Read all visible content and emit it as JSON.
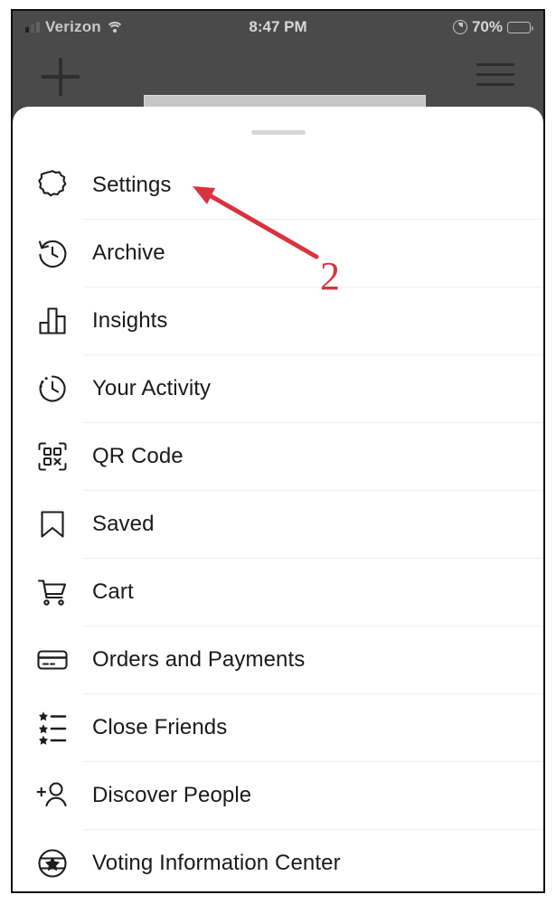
{
  "status_bar": {
    "carrier": "Verizon",
    "time": "8:47 PM",
    "battery_percent": "70%",
    "battery_level": 70,
    "wifi_icon": "wifi-icon",
    "signal_icon": "cellular-signal-icon",
    "location_icon": "location-services-icon",
    "battery_icon": "battery-icon"
  },
  "app_bar": {
    "add_icon": "plus-icon",
    "menu_icon": "hamburger-menu-icon",
    "username_redacted": ""
  },
  "sheet": {
    "grabber": "drag-handle",
    "items": [
      {
        "label": "Settings",
        "icon": "gear-icon"
      },
      {
        "label": "Archive",
        "icon": "archive-clock-icon"
      },
      {
        "label": "Insights",
        "icon": "insights-bar-chart-icon"
      },
      {
        "label": "Your Activity",
        "icon": "activity-clock-icon"
      },
      {
        "label": "QR Code",
        "icon": "qr-code-icon"
      },
      {
        "label": "Saved",
        "icon": "bookmark-icon"
      },
      {
        "label": "Cart",
        "icon": "shopping-cart-icon"
      },
      {
        "label": "Orders and Payments",
        "icon": "credit-card-icon"
      },
      {
        "label": "Close Friends",
        "icon": "star-list-icon"
      },
      {
        "label": "Discover People",
        "icon": "add-person-icon"
      },
      {
        "label": "Voting Information Center",
        "icon": "voting-badge-icon"
      }
    ]
  },
  "annotation": {
    "step_number": "2",
    "arrow_color": "#d9333f",
    "points_to": "Settings"
  },
  "colors": {
    "header_bg": "#4a4a4a",
    "sheet_bg": "#ffffff",
    "text": "#1a1a1a",
    "divider": "#efefef",
    "redaction": "#c6c6c6",
    "annotation_red": "#d9333f"
  }
}
